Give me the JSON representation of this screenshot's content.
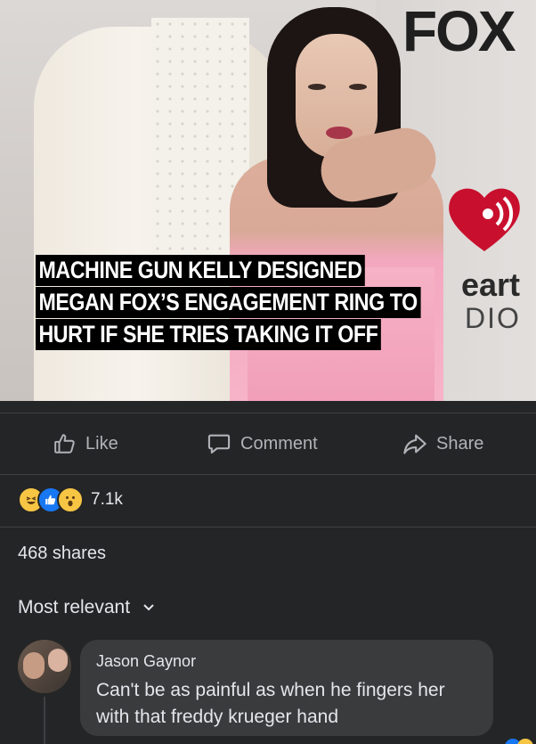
{
  "post_image": {
    "wall_logo_text": "FOX",
    "sponsor_text_1": "eart",
    "sponsor_text_2": "DIO",
    "caption_lines": [
      "MACHINE GUN KELLY DESIGNED",
      "MEGAN FOX’S ENGAGEMENT RING TO",
      "HURT IF SHE TRIES TAKING IT OFF"
    ]
  },
  "actions": {
    "like_label": "Like",
    "comment_label": "Comment",
    "share_label": "Share",
    "like_icon": "thumbs-up-icon",
    "comment_icon": "speech-bubble-icon",
    "share_icon": "share-arrow-icon"
  },
  "reactions": {
    "types": [
      "haha",
      "like",
      "wow"
    ],
    "count": "7.1k"
  },
  "shares_text": "468 shares",
  "comments_sort": {
    "label": "Most relevant",
    "icon": "chevron-down-icon"
  },
  "comments": [
    {
      "author": "Jason Gaynor",
      "text": "Can't be as painful as when he fingers her with that freddy krueger hand"
    }
  ],
  "colors": {
    "background": "#242526",
    "bubble": "#3a3b3c",
    "muted_text": "#b0b3b8",
    "like_blue": "#1877f2",
    "reaction_yellow": "#f7c544"
  }
}
